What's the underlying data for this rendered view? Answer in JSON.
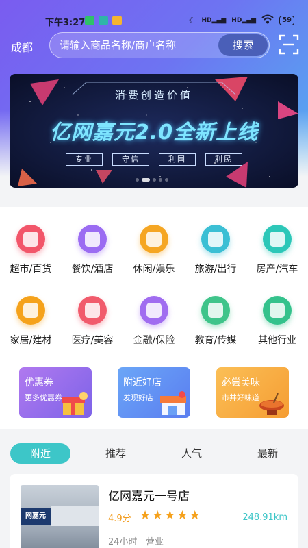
{
  "status_bar": {
    "time": "下午3:27",
    "signal_labels": [
      "HD",
      "HD"
    ],
    "battery": "59"
  },
  "header": {
    "city": "成都",
    "search_placeholder": "请输入商品名称/商户名称",
    "search_button": "搜索",
    "scan_icon": "scan-icon"
  },
  "banner": {
    "slogan": "消费创造价值",
    "title": "亿网嘉元2.0全新上线",
    "tags": [
      "专业",
      "守信",
      "利国",
      "利民"
    ],
    "dot_count": 5,
    "active_dot": 1
  },
  "categories": [
    {
      "label": "超市/百货",
      "icon": "supermarket-icon",
      "color": "#f2566a"
    },
    {
      "label": "餐饮/酒店",
      "icon": "restaurant-icon",
      "color": "#9b6cf2"
    },
    {
      "label": "休闲/娱乐",
      "icon": "leisure-icon",
      "color": "#f5a623"
    },
    {
      "label": "旅游/出行",
      "icon": "travel-icon",
      "color": "#3bbfd4"
    },
    {
      "label": "房产/汽车",
      "icon": "realestate-icon",
      "color": "#2cc7b8"
    },
    {
      "label": "家居/建材",
      "icon": "furniture-icon",
      "color": "#f5a21b"
    },
    {
      "label": "医疗/美容",
      "icon": "medical-icon",
      "color": "#f15b6c"
    },
    {
      "label": "金融/保险",
      "icon": "finance-icon",
      "color": "#a06cf0"
    },
    {
      "label": "教育/传媒",
      "icon": "education-icon",
      "color": "#3fc48a"
    },
    {
      "label": "其他行业",
      "icon": "other-icon",
      "color": "#34c28c"
    }
  ],
  "promos": [
    {
      "title": "优惠券",
      "subtitle": "更多优惠券",
      "color_from": "#b079ef",
      "color_to": "#7d63e8"
    },
    {
      "title": "附近好店",
      "subtitle": "发现好店",
      "color_from": "#6ba6f7",
      "color_to": "#5a7df0"
    },
    {
      "title": "必尝美味",
      "subtitle": "市井好味道",
      "color_from": "#fbbf56",
      "color_to": "#f59d33"
    }
  ],
  "tabs": [
    "附近",
    "推荐",
    "人气",
    "最新"
  ],
  "active_tab": 0,
  "shop": {
    "name": "亿网嘉元一号店",
    "rating": "4.9分",
    "stars": 5,
    "distance": "248.91km",
    "hours": "24小时",
    "status": "营业",
    "sign_text": "网嘉元"
  }
}
